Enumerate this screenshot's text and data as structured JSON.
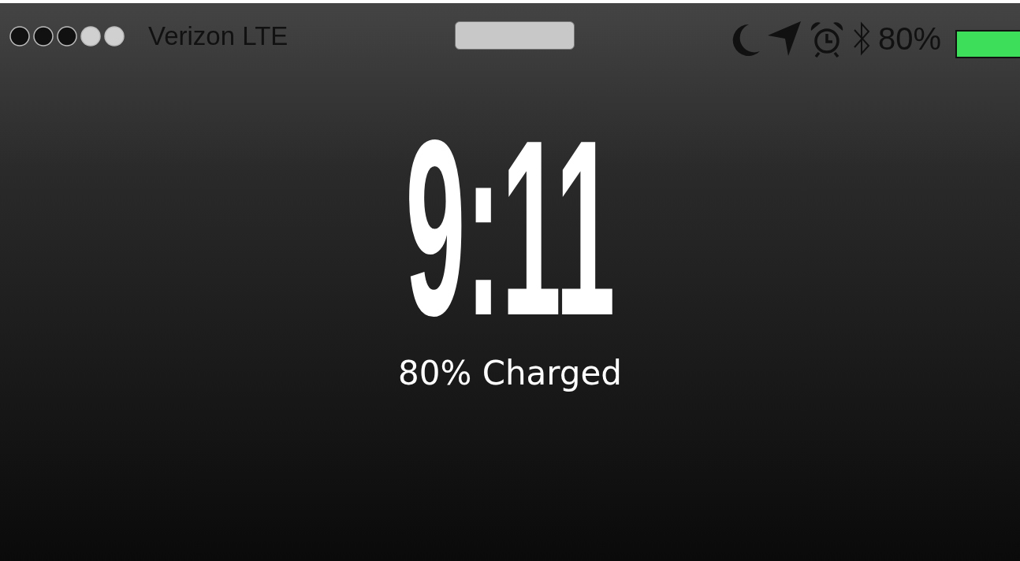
{
  "status_bar": {
    "carrier": "Verizon LTE",
    "battery_percent": "80%"
  },
  "lock_screen": {
    "time": "9:11",
    "charge_status": "80% Charged"
  }
}
